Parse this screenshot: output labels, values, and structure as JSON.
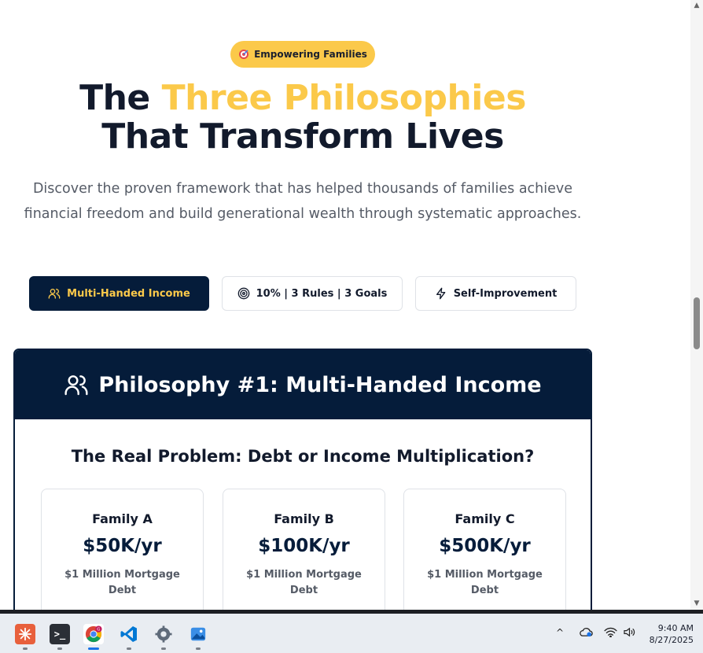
{
  "badge": {
    "icon": "target-dart-icon",
    "label": "Empowering Families"
  },
  "heading": {
    "part1": "The ",
    "accent": "Three Philosophies",
    "line2": "That Transform Lives"
  },
  "subtitle": "Discover the proven framework that has helped thousands of families achieve financial freedom and build generational wealth through systematic approaches.",
  "tabs": [
    {
      "label": "Multi-Handed Income",
      "icon": "users-icon",
      "active": true
    },
    {
      "label": "10% | 3 Rules | 3 Goals",
      "icon": "target-icon",
      "active": false
    },
    {
      "label": "Self-Improvement",
      "icon": "lightning-icon",
      "active": false
    }
  ],
  "card": {
    "title": "Philosophy #1: Multi-Handed Income",
    "subtitle": "The Real Problem: Debt or Income Multiplication?",
    "families": [
      {
        "name": "Family A",
        "income": "$50K/yr",
        "debt": "$1 Million Mortgage Debt"
      },
      {
        "name": "Family B",
        "income": "$100K/yr",
        "debt": "$1 Million Mortgage Debt"
      },
      {
        "name": "Family C",
        "income": "$500K/yr",
        "debt": "$1 Million Mortgage Debt"
      }
    ]
  },
  "colors": {
    "navy": "#051c3a",
    "gold": "#fbc94a",
    "text": "#121a2c",
    "muted": "#555b66"
  },
  "taskbar": {
    "apps": [
      "claude-icon",
      "terminal-icon",
      "chrome-icon",
      "vscode-icon",
      "settings-icon",
      "photos-icon"
    ],
    "clock": {
      "time": "9:40 AM",
      "date": "8/27/2025"
    }
  }
}
